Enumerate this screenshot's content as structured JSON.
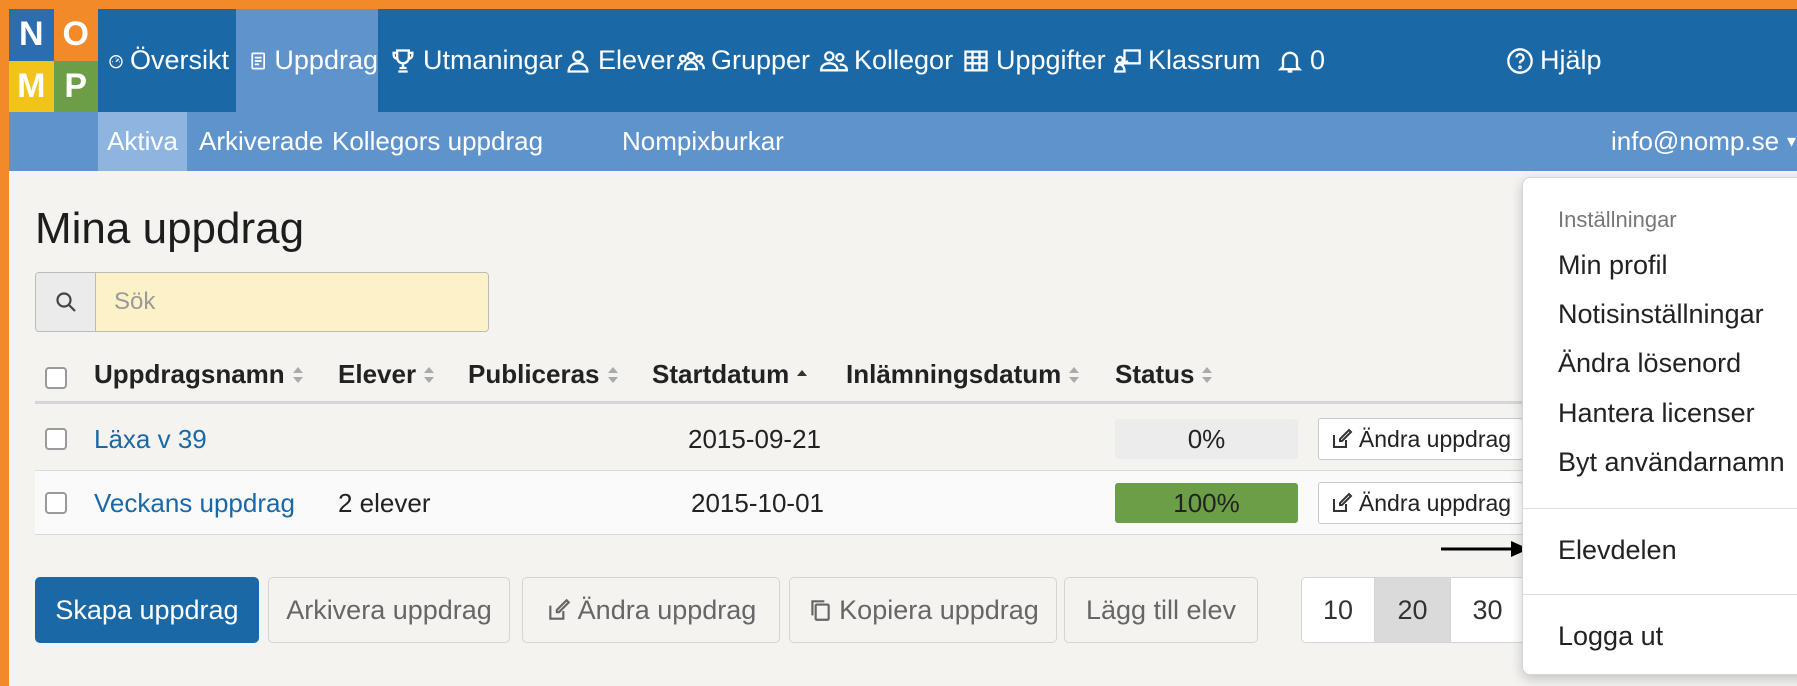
{
  "logo": {
    "letters": [
      "N",
      "O",
      "M",
      "P"
    ],
    "colors": [
      "#2c6db0",
      "#f28a2a",
      "#f2c41a",
      "#6b9e47"
    ]
  },
  "nav": {
    "items": [
      {
        "label": "Översikt",
        "icon": "dashboard-icon"
      },
      {
        "label": "Uppdrag",
        "icon": "book-icon"
      },
      {
        "label": "Utmaningar",
        "icon": "trophy-icon"
      },
      {
        "label": "Elever",
        "icon": "user-icon"
      },
      {
        "label": "Grupper",
        "icon": "group-icon"
      },
      {
        "label": "Kollegor",
        "icon": "users-icon"
      },
      {
        "label": "Uppgifter",
        "icon": "grid-icon"
      },
      {
        "label": "Klassrum",
        "icon": "classroom-icon"
      }
    ],
    "notifications": "0",
    "help": "Hjälp"
  },
  "subnav": {
    "items": [
      "Aktiva",
      "Arkiverade",
      "Kollegors uppdrag",
      "Nompixburkar"
    ],
    "user": "info@nomp.se"
  },
  "page": {
    "title": "Mina uppdrag",
    "search_placeholder": "Sök"
  },
  "table": {
    "headers": [
      "Uppdragsnamn",
      "Elever",
      "Publiceras",
      "Startdatum",
      "Inlämningsdatum",
      "Status"
    ],
    "rows": [
      {
        "name": "Läxa v 39",
        "students": "",
        "publish": "",
        "start": "2015-09-21",
        "due": "",
        "status": "0%",
        "progress": 0,
        "action": "Ändra uppdrag"
      },
      {
        "name": "Veckans uppdrag",
        "students": "2 elever",
        "publish": "",
        "start": "2015-10-01",
        "due": "",
        "status": "100%",
        "progress": 1,
        "action": "Ändra uppdrag"
      }
    ]
  },
  "actions": {
    "create": "Skapa uppdrag",
    "archive": "Arkivera uppdrag",
    "edit": "Ändra uppdrag",
    "copy": "Kopiera uppdrag",
    "add_student": "Lägg till elev"
  },
  "pagination": [
    "10",
    "20",
    "30"
  ],
  "dropdown": {
    "header": "Inställningar",
    "items": [
      "Min profil",
      "Notisinställningar",
      "Ändra lösenord",
      "Hantera licenser",
      "Byt användarnamn"
    ],
    "student_part": "Elevdelen",
    "logout": "Logga ut"
  },
  "colors": {
    "nav": "#1a68a6",
    "subnav": "#5e93cc",
    "border": "#f28a2a",
    "success": "#6b9e47"
  }
}
